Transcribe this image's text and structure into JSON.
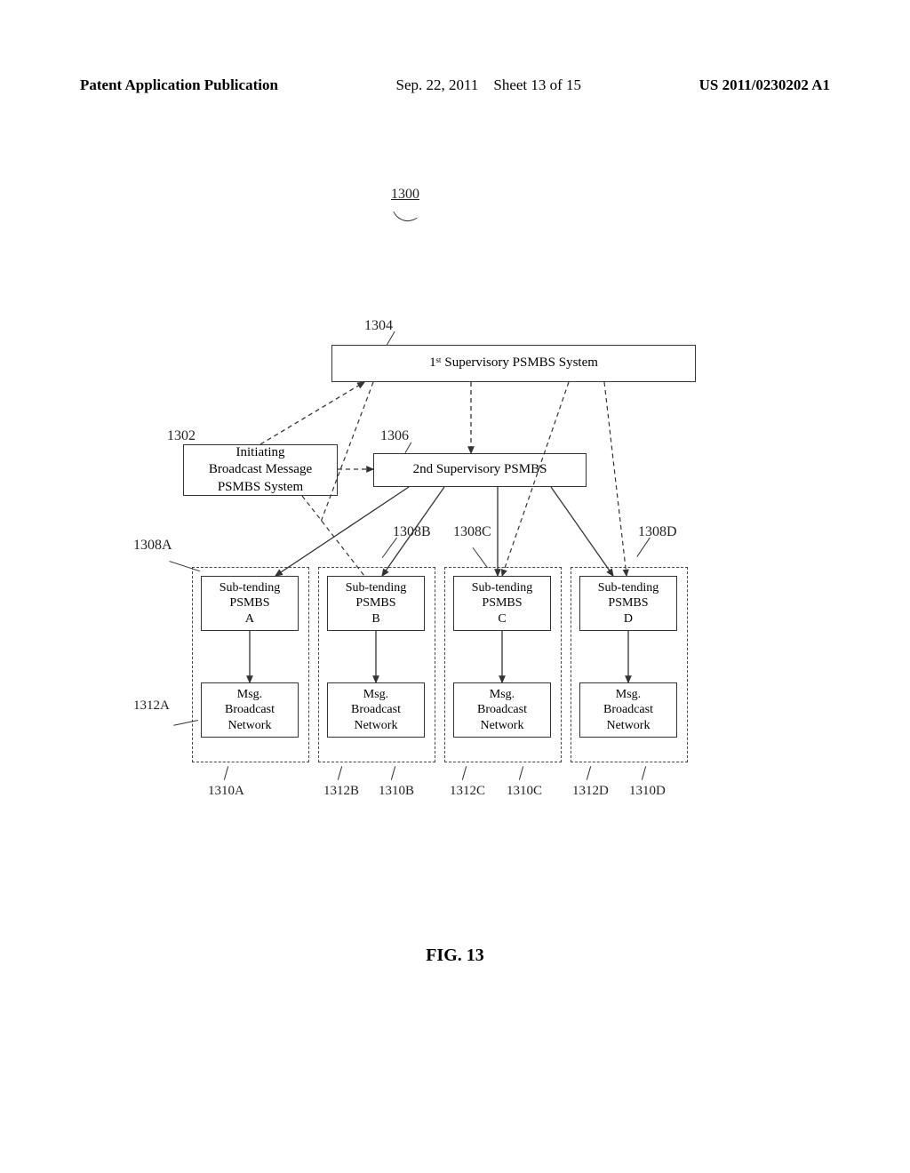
{
  "header": {
    "left": "Patent Application Publication",
    "date": "Sep. 22, 2011",
    "sheet": "Sheet 13 of 15",
    "docnum": "US 2011/0230202 A1"
  },
  "diagram": {
    "ref_1300": "1300",
    "ref_1304": "1304",
    "ref_1302": "1302",
    "ref_1306": "1306",
    "ref_1308A": "1308A",
    "ref_1308B": "1308B",
    "ref_1308C": "1308C",
    "ref_1308D": "1308D",
    "ref_1312A": "1312A",
    "ref_1310A": "1310A",
    "ref_1312B": "1312B",
    "ref_1310B": "1310B",
    "ref_1312C": "1312C",
    "ref_1310C": "1310C",
    "ref_1312D": "1312D",
    "ref_1310D": "1310D",
    "first_sup": "1ˢᵗ Supervisory PSMBS System",
    "second_sup": "2nd Supervisory PSMBS",
    "initiating": "Initiating\nBroadcast Message\nPSMBS System",
    "sub": {
      "a": "Sub-tending\nPSMBS\nA",
      "b": "Sub-tending\nPSMBS\nB",
      "c": "Sub-tending\nPSMBS\nC",
      "d": "Sub-tending\nPSMBS\nD"
    },
    "msg": "Msg.\nBroadcast\nNetwork"
  },
  "figure_label": "FIG. 13"
}
